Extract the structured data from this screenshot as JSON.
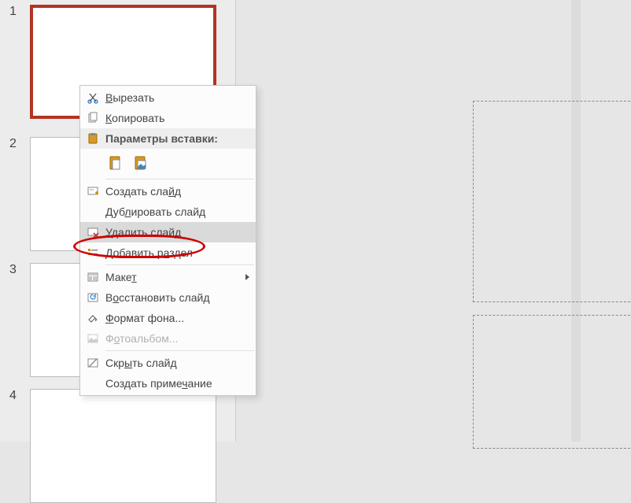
{
  "slides": [
    {
      "number": "1"
    },
    {
      "number": "2"
    },
    {
      "number": "3"
    },
    {
      "number": "4"
    }
  ],
  "context_menu": {
    "cut": "Вырезать",
    "copy": "Копировать",
    "paste_options_header": "Параметры вставки:",
    "new_slide": "Создать слайд",
    "duplicate_slide": "Дублировать слайд",
    "delete_slide": "Удалить слайд",
    "add_section": "Добавить раздел",
    "layout": "Макет",
    "reset_slide": "Восстановить слайд",
    "format_background": "Формат фона...",
    "photo_album": "Фотоальбом...",
    "hide_slide": "Скрыть слайд",
    "new_comment": "Создать примечание"
  },
  "icons": {
    "scissors": "scissors-icon",
    "copy": "copy-icon",
    "clipboard": "clipboard-icon",
    "paste_theme": "paste-theme-icon",
    "paste_picture": "paste-picture-icon",
    "new_slide": "new-slide-icon",
    "delete_slide": "delete-slide-icon",
    "section": "section-icon",
    "layout": "layout-icon",
    "reset": "reset-icon",
    "format_bg": "format-bg-icon",
    "photo_album": "photo-album-icon",
    "hide_slide": "hide-slide-icon"
  }
}
